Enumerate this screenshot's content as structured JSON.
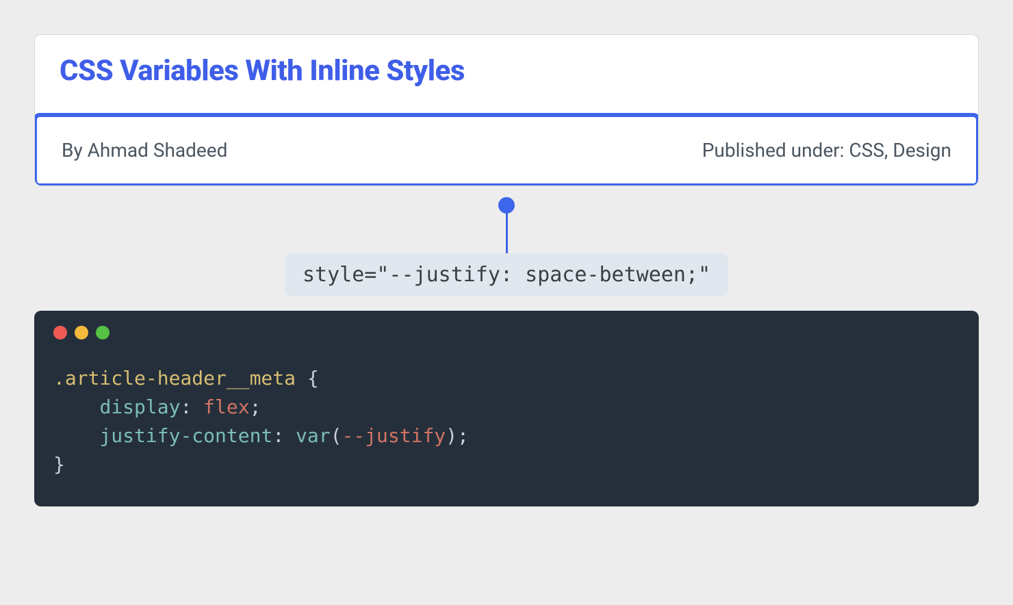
{
  "article": {
    "title": "CSS Variables With Inline Styles",
    "byline": "By Ahmad Shadeed",
    "published": "Published under: CSS, Design"
  },
  "inline_style_label": "style=\"--justify: space-between;\"",
  "code": {
    "selector": ".article-header__meta",
    "prop1": "display",
    "val1": "flex",
    "prop2": "justify-content",
    "func": "var",
    "var": "--justify"
  }
}
